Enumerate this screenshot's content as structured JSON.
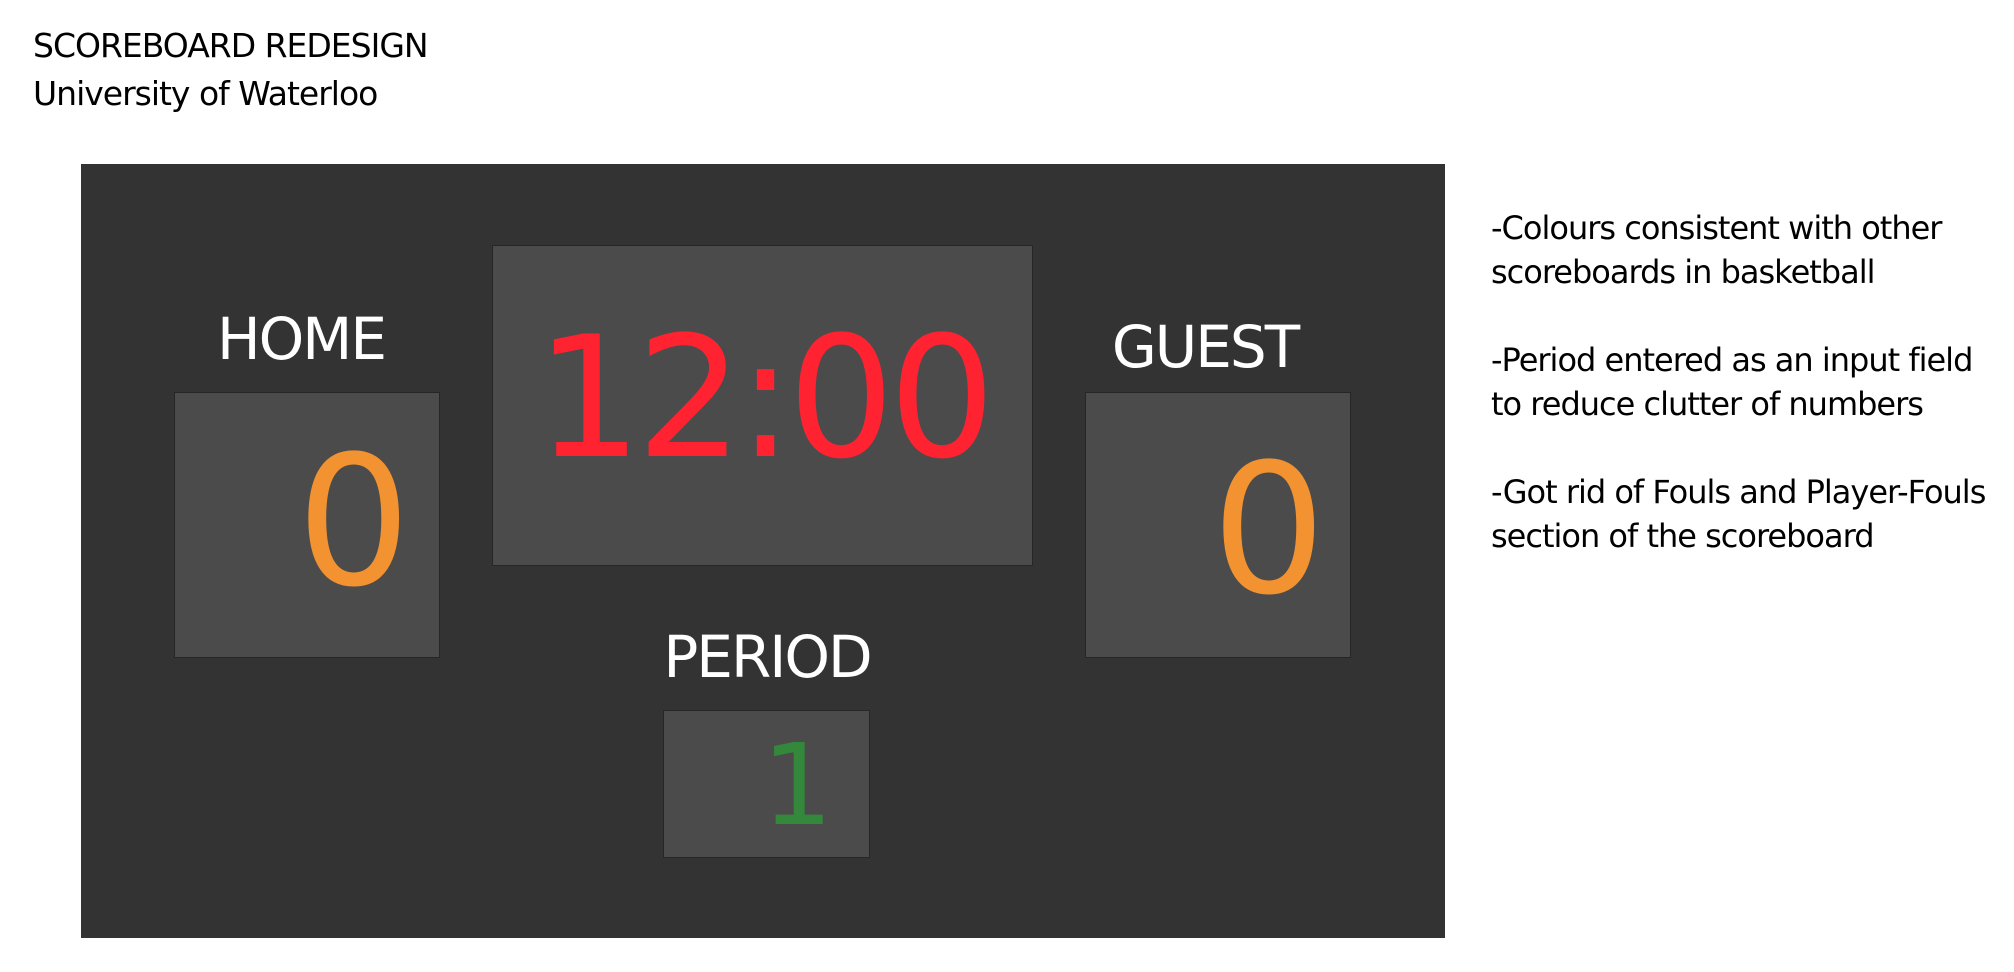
{
  "header": {
    "title": "SCOREBOARD REDESIGN",
    "subtitle": "University of Waterloo"
  },
  "scoreboard": {
    "home": {
      "label": "HOME",
      "score": "0"
    },
    "clock": {
      "time": "12:00"
    },
    "guest": {
      "label": "GUEST",
      "score": "0"
    },
    "period": {
      "label": "PERIOD",
      "value": "1"
    }
  },
  "notes": [
    "-Colours consistent with other scoreboards in basketball",
    "-Period entered as an input field to reduce clutter of numbers",
    "-Got rid of Fouls and Player-Fouls section of the scoreboard"
  ],
  "colors": {
    "board_background": "#333333",
    "panel_background": "#4b4b4b",
    "clock": "#ff2332",
    "score": "#f29230",
    "period": "#34883b",
    "label": "#ffffff"
  }
}
